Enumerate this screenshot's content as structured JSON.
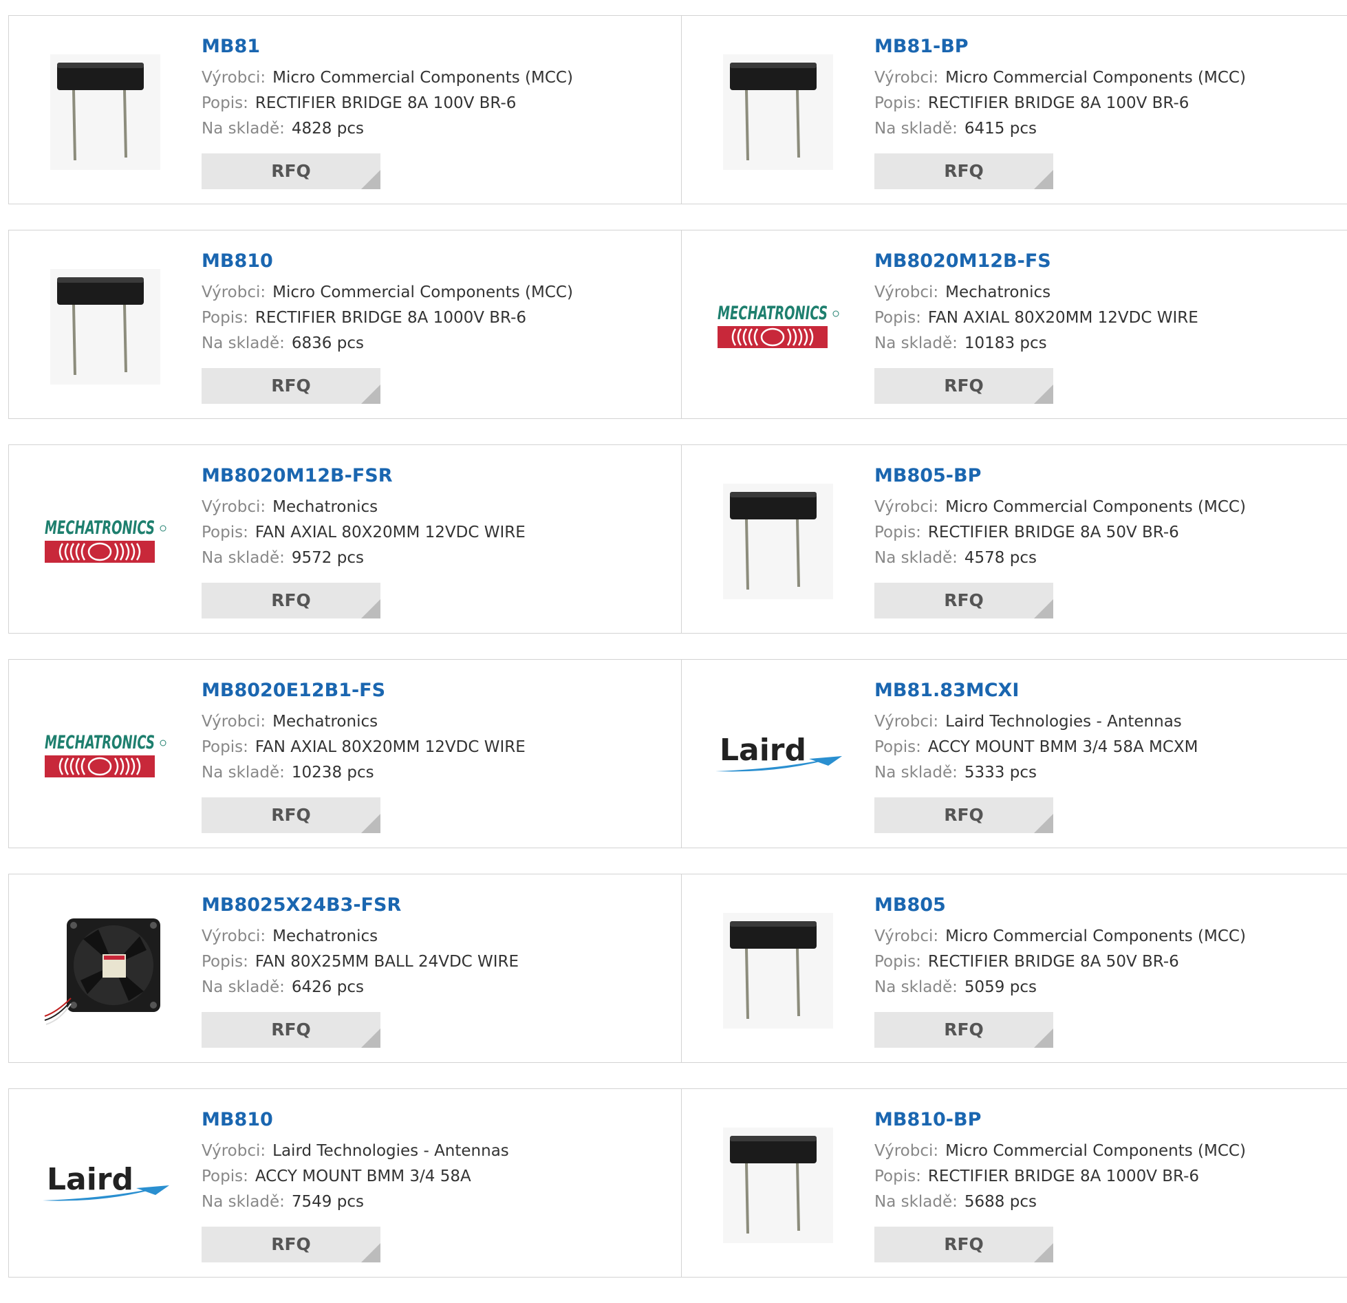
{
  "labels": {
    "manufacturer": "Výrobci:",
    "description": "Popis:",
    "stock": "Na skladě:"
  },
  "products": [
    {
      "part": "MB81",
      "manufacturer": "Micro Commercial Components (MCC)",
      "description": "RECTIFIER BRIDGE 8A 100V BR-6",
      "stock": "4828 pcs",
      "image": "bridge-rectifier",
      "rfq": "RFQ"
    },
    {
      "part": "MB81-BP",
      "manufacturer": "Micro Commercial Components (MCC)",
      "description": "RECTIFIER BRIDGE 8A 100V BR-6",
      "stock": "6415 pcs",
      "image": "bridge-rectifier",
      "rfq": "RFQ"
    },
    {
      "part": "MB810",
      "manufacturer": "Micro Commercial Components (MCC)",
      "description": "RECTIFIER BRIDGE 8A 1000V BR-6",
      "stock": "6836 pcs",
      "image": "bridge-rectifier",
      "rfq": "RFQ"
    },
    {
      "part": "MB8020M12B-FS",
      "manufacturer": "Mechatronics",
      "description": "FAN AXIAL 80X20MM 12VDC WIRE",
      "stock": "10183 pcs",
      "image": "mechatronics-logo",
      "rfq": "RFQ"
    },
    {
      "part": "MB8020M12B-FSR",
      "manufacturer": "Mechatronics",
      "description": "FAN AXIAL 80X20MM 12VDC WIRE",
      "stock": "9572 pcs",
      "image": "mechatronics-logo",
      "rfq": "RFQ"
    },
    {
      "part": "MB805-BP",
      "manufacturer": "Micro Commercial Components (MCC)",
      "description": "RECTIFIER BRIDGE 8A 50V BR-6",
      "stock": "4578 pcs",
      "image": "bridge-rectifier",
      "rfq": "RFQ"
    },
    {
      "part": "MB8020E12B1-FS",
      "manufacturer": "Mechatronics",
      "description": "FAN AXIAL 80X20MM 12VDC WIRE",
      "stock": "10238 pcs",
      "image": "mechatronics-logo",
      "rfq": "RFQ"
    },
    {
      "part": "MB81.83MCXI",
      "manufacturer": "Laird Technologies - Antennas",
      "description": "ACCY MOUNT BMM 3/4 58A MCXM",
      "stock": "5333 pcs",
      "image": "laird-logo",
      "rfq": "RFQ"
    },
    {
      "part": "MB8025X24B3-FSR",
      "manufacturer": "Mechatronics",
      "description": "FAN 80X25MM BALL 24VDC WIRE",
      "stock": "6426 pcs",
      "image": "fan",
      "rfq": "RFQ"
    },
    {
      "part": "MB805",
      "manufacturer": "Micro Commercial Components (MCC)",
      "description": "RECTIFIER BRIDGE 8A 50V BR-6",
      "stock": "5059 pcs",
      "image": "bridge-rectifier",
      "rfq": "RFQ"
    },
    {
      "part": "MB810",
      "manufacturer": "Laird Technologies - Antennas",
      "description": "ACCY MOUNT BMM 3/4 58A",
      "stock": "7549 pcs",
      "image": "laird-logo",
      "rfq": "RFQ"
    },
    {
      "part": "MB810-BP",
      "manufacturer": "Micro Commercial Components (MCC)",
      "description": "RECTIFIER BRIDGE 8A 1000V BR-6",
      "stock": "5688 pcs",
      "image": "bridge-rectifier",
      "rfq": "RFQ"
    }
  ],
  "logos": {
    "mechatronics": "MECHATRONICS",
    "laird": "Laird"
  },
  "colors": {
    "part_link": "#1a66b0",
    "label": "#888888",
    "rfq_bg": "#e6e6e6",
    "mechatronics_green": "#1e7f6e",
    "mechatronics_red": "#c8283a",
    "laird_blue": "#2a8fd0"
  }
}
